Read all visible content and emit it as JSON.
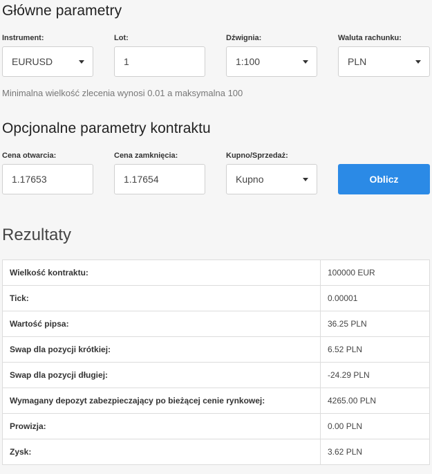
{
  "main_params": {
    "title": "Główne parametry",
    "instrument": {
      "label": "Instrument:",
      "value": "EURUSD"
    },
    "lot": {
      "label": "Lot:",
      "value": "1"
    },
    "leverage": {
      "label": "Dźwignia:",
      "value": "1:100"
    },
    "currency": {
      "label": "Waluta rachunku:",
      "value": "PLN"
    },
    "note": "Minimalna wielkość zlecenia wynosi 0.01 a maksymalna 100"
  },
  "optional_params": {
    "title": "Opcjonalne parametry kontraktu",
    "open_price": {
      "label": "Cena otwarcia:",
      "value": "1.17653"
    },
    "close_price": {
      "label": "Cena zamknięcia:",
      "value": "1.17654"
    },
    "side": {
      "label": "Kupno/Sprzedaż:",
      "value": "Kupno"
    },
    "calculate_label": "Oblicz"
  },
  "results": {
    "title": "Rezultaty",
    "rows": [
      {
        "key": "Wielkość kontraktu:",
        "value": "100000 EUR"
      },
      {
        "key": "Tick:",
        "value": "0.00001"
      },
      {
        "key": "Wartość pipsa:",
        "value": "36.25 PLN"
      },
      {
        "key": "Swap dla pozycji krótkiej:",
        "value": "6.52 PLN"
      },
      {
        "key": "Swap dla pozycji długiej:",
        "value": "-24.29 PLN"
      },
      {
        "key": "Wymagany depozyt zabezpieczający po bieżącej cenie rynkowej:",
        "value": "4265.00 PLN"
      },
      {
        "key": "Prowizja:",
        "value": "0.00 PLN"
      },
      {
        "key": "Zysk:",
        "value": "3.62 PLN"
      }
    ]
  },
  "colors": {
    "accent": "#2b8ae6",
    "background": "#f6f6f6"
  }
}
